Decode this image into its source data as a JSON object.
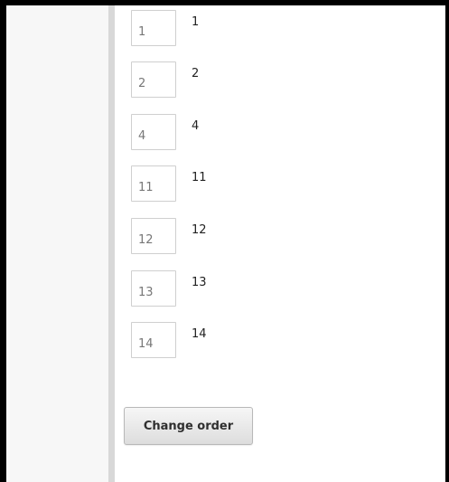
{
  "order_list": {
    "items": [
      {
        "input_value": "1",
        "label": "1"
      },
      {
        "input_value": "2",
        "label": "2"
      },
      {
        "input_value": "4",
        "label": "4"
      },
      {
        "input_value": "11",
        "label": "11"
      },
      {
        "input_value": "12",
        "label": "12"
      },
      {
        "input_value": "13",
        "label": "13"
      },
      {
        "input_value": "14",
        "label": "14"
      }
    ]
  },
  "actions": {
    "change_order_label": "Change order"
  },
  "colors": {
    "left_panel": "#f7f7f7",
    "divider": "#d8d8d8",
    "input_border": "#cfcfcf",
    "button_top": "#f6f6f6",
    "button_bottom": "#dddddd"
  }
}
